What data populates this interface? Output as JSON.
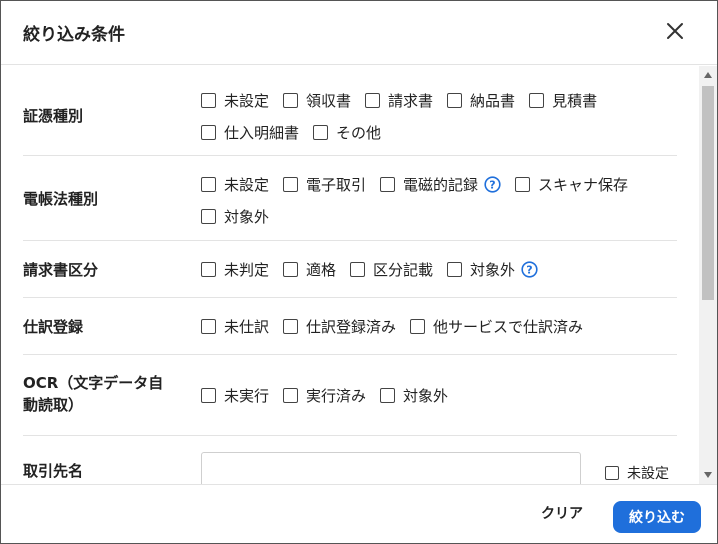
{
  "dialog": {
    "title": "絞り込み条件",
    "close_icon": "close-icon"
  },
  "sections": {
    "voucher_type": {
      "label": "証憑種別",
      "options": [
        "未設定",
        "領収書",
        "請求書",
        "納品書",
        "見積書",
        "仕入明細書",
        "その他"
      ]
    },
    "ebook_type": {
      "label": "電帳法種別",
      "options": [
        "未設定",
        "電子取引",
        "電磁的記録",
        "スキャナ保存",
        "対象外"
      ]
    },
    "invoice_class": {
      "label": "請求書区分",
      "options": [
        "未判定",
        "適格",
        "区分記載",
        "対象外"
      ]
    },
    "journal": {
      "label": "仕訳登録",
      "options": [
        "未仕訳",
        "仕訳登録済み",
        "他サービスで仕訳済み"
      ]
    },
    "ocr": {
      "label_line1": "OCR（文字データ自",
      "label_line2": "動読取）",
      "options": [
        "未実行",
        "実行済み",
        "対象外"
      ]
    },
    "partner": {
      "label": "取引先名",
      "input_value": "",
      "unset_label": "未設定"
    }
  },
  "footer": {
    "clear_label": "クリア",
    "apply_label": "絞り込む"
  },
  "colors": {
    "accent": "#1f6fdb",
    "help_icon": "#1f6fdb",
    "divider": "#e3e3e3"
  }
}
